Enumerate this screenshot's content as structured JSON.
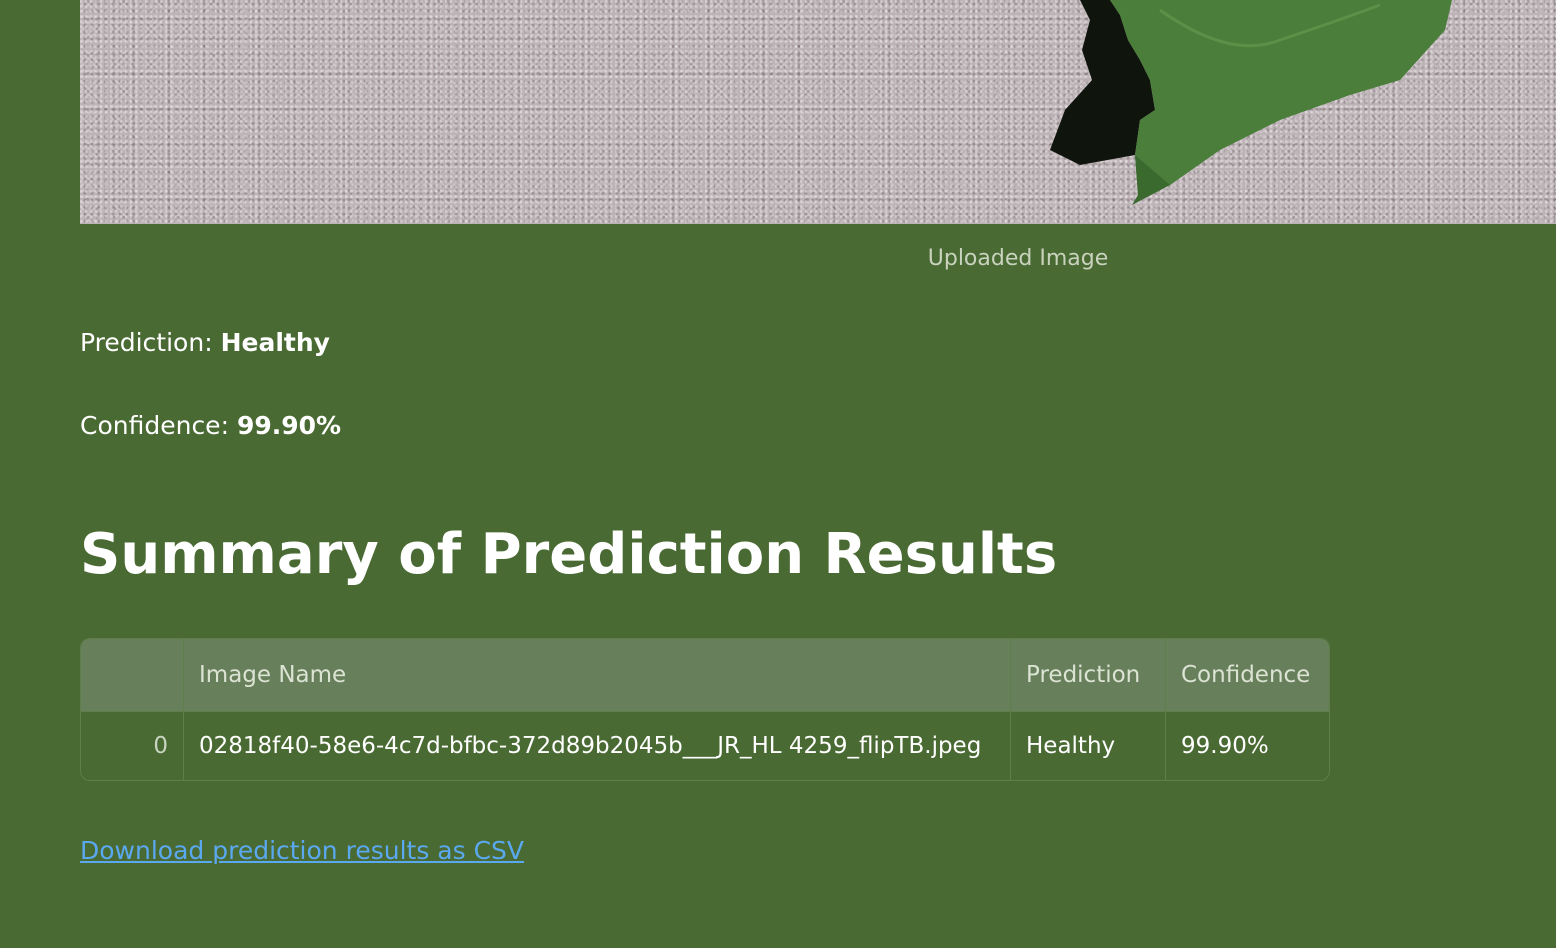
{
  "image": {
    "caption": "Uploaded Image"
  },
  "result": {
    "prediction_label": "Prediction: ",
    "prediction_value": "Healthy",
    "confidence_label": "Confidence: ",
    "confidence_value": "99.90%"
  },
  "summary": {
    "title": "Summary of Prediction Results",
    "columns": [
      "",
      "Image Name",
      "Prediction",
      "Confidence"
    ],
    "rows": [
      {
        "index": "0",
        "image_name": "02818f40-58e6-4c7d-bfbc-372d89b2045b___JR_HL 4259_flipTB.jpeg",
        "prediction": "Healthy",
        "confidence": "99.90%"
      }
    ]
  },
  "download": {
    "label": "Download prediction results as CSV"
  },
  "colors": {
    "background": "#4a6a33",
    "link": "#5aa8f0",
    "table_header": "#677f5a"
  }
}
